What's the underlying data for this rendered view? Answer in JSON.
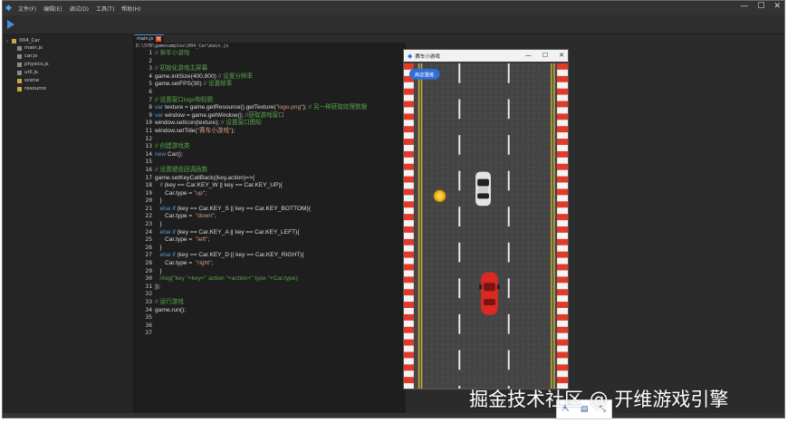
{
  "menu": [
    "文件(F)",
    "编辑(E)",
    "调试(D)",
    "工具(T)",
    "帮助(H)"
  ],
  "window_buttons": [
    "—",
    "☐",
    "✕"
  ],
  "tree": {
    "root": "004_Car",
    "items": [
      "main.js",
      "car.js",
      "physics.js",
      "util.js",
      "scene",
      "resource"
    ]
  },
  "editor": {
    "tab": "main.js",
    "path": "D:\\SYB\\gamesamples\\004_Car\\main.js",
    "lines": [
      [
        [
          "c",
          "// 赛车小游戏"
        ]
      ],
      [],
      [
        [
          "c",
          "// 初始化游戏主屏幕"
        ]
      ],
      [
        [
          "t",
          "game.initSize(400,800)"
        ],
        [
          "c",
          " // 设置分辨率"
        ]
      ],
      [
        [
          "t",
          "game.setFPS(30)"
        ],
        [
          "c",
          " // 设置帧率"
        ]
      ],
      [],
      [
        [
          "c",
          "// 设置窗口logo和标题"
        ]
      ],
      [
        [
          "k",
          "var"
        ],
        [
          "t",
          " texture = game.getResource().getTexture("
        ],
        [
          "s",
          "\"logo.png\""
        ],
        [
          "t",
          ");"
        ],
        [
          "c",
          " // 另一种获取纹理数据"
        ]
      ],
      [
        [
          "k",
          "var"
        ],
        [
          "t",
          " window = game.getWindow();"
        ],
        [
          "c",
          " //获取游戏窗口"
        ]
      ],
      [
        [
          "t",
          "window.setIcon(texture);"
        ],
        [
          "c",
          " // 设置窗口图标"
        ]
      ],
      [
        [
          "t",
          "window.setTitle("
        ],
        [
          "s",
          "\"赛车小游戏\""
        ],
        [
          "t",
          ");"
        ]
      ],
      [],
      [
        [
          "c",
          "// 创建游戏类"
        ]
      ],
      [
        [
          "k",
          "new"
        ],
        [
          "t",
          " Car();"
        ]
      ],
      [],
      [
        [
          "c",
          "// 设置键盘回调函数"
        ]
      ],
      [
        [
          "t",
          "game.setKeyCallBack((key,action)=>{"
        ]
      ],
      [
        [
          "t",
          "   "
        ],
        [
          "k",
          "if"
        ],
        [
          "t",
          " (key == Car.KEY_W || key == Car.KEY_UP){"
        ]
      ],
      [
        [
          "t",
          "      Car.type = "
        ],
        [
          "s",
          "\"up\""
        ],
        [
          "t",
          ";"
        ]
      ],
      [
        [
          "t",
          "   }"
        ]
      ],
      [
        [
          "t",
          "   "
        ],
        [
          "k",
          "else if"
        ],
        [
          "t",
          " (key == Car.KEY_S || key == Car.KEY_BOTTOM){"
        ]
      ],
      [
        [
          "t",
          "      Car.type =  "
        ],
        [
          "s",
          "\"down\""
        ],
        [
          "t",
          ";"
        ]
      ],
      [
        [
          "t",
          "   }"
        ]
      ],
      [
        [
          "t",
          "   "
        ],
        [
          "k",
          "else if"
        ],
        [
          "t",
          " (key == Car.KEY_A || key == Car.KEY_LEFT){"
        ]
      ],
      [
        [
          "t",
          "      Car.type =  "
        ],
        [
          "s",
          "\"left\""
        ],
        [
          "t",
          ";"
        ]
      ],
      [
        [
          "t",
          "   }"
        ]
      ],
      [
        [
          "t",
          "   "
        ],
        [
          "k",
          "else if"
        ],
        [
          "t",
          " (key == Car.KEY_D || key == Car.KEY_RIGHT){"
        ]
      ],
      [
        [
          "t",
          "      Car.type =  "
        ],
        [
          "s",
          "\"right\""
        ],
        [
          "t",
          ";"
        ]
      ],
      [
        [
          "t",
          "   }"
        ]
      ],
      [
        [
          "c",
          "   //log(\"key \"+key+\" action \"+action+\" type \"+Car.type);"
        ]
      ],
      [
        [
          "t",
          "});"
        ]
      ],
      [],
      [
        [
          "c",
          "// 运行游戏"
        ]
      ],
      [
        [
          "t",
          "game.run();"
        ]
      ],
      [],
      [],
      []
    ]
  },
  "game_window": {
    "title": "赛车小游戏",
    "button": "再定重练"
  },
  "watermark": "掘金技术社区 @ 开维游戏引擎",
  "colors": {
    "keyword": "#569cd6",
    "comment": "#57a64a",
    "string": "#d69d85",
    "accent": "#3f8fe0"
  }
}
